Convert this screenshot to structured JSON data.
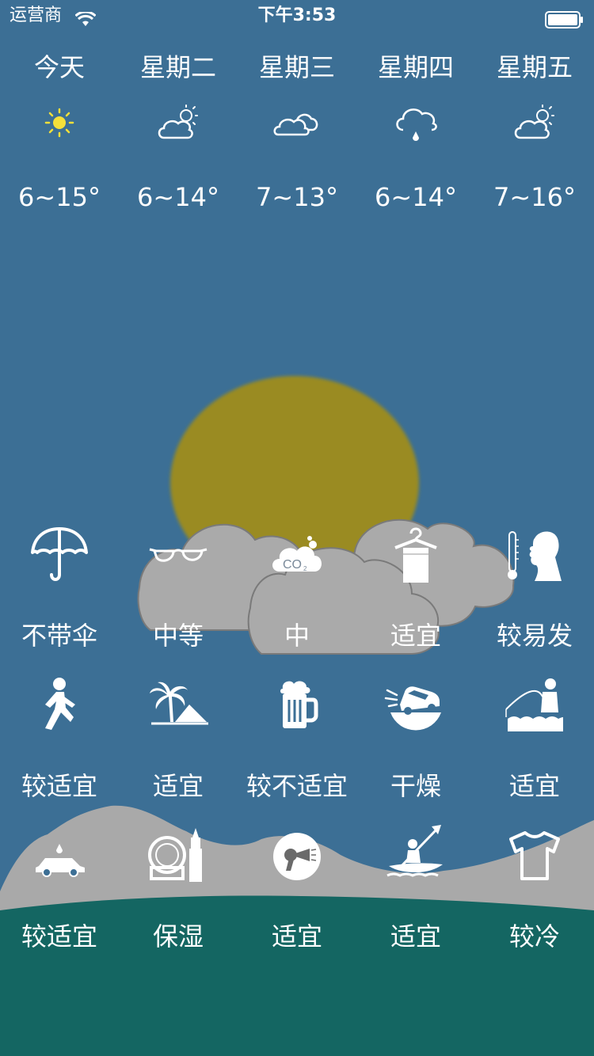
{
  "status": {
    "carrier": "运营商",
    "time": "下午3:53"
  },
  "forecast": [
    {
      "day": "今天",
      "icon": "sun-icon",
      "temp": "6~15°"
    },
    {
      "day": "星期二",
      "icon": "partly-cloudy-icon",
      "temp": "6~14°"
    },
    {
      "day": "星期三",
      "icon": "cloudy-icon",
      "temp": "7~13°"
    },
    {
      "day": "星期四",
      "icon": "rain-icon",
      "temp": "6~14°"
    },
    {
      "day": "星期五",
      "icon": "partly-cloudy-icon",
      "temp": "7~16°"
    }
  ],
  "indices": [
    {
      "icon": "umbrella-icon",
      "label": "不带伞"
    },
    {
      "icon": "sunglasses-icon",
      "label": "中等"
    },
    {
      "icon": "co2-icon",
      "label": "中"
    },
    {
      "icon": "clothes-drying-icon",
      "label": "适宜"
    },
    {
      "icon": "thermometer-person-icon",
      "label": "较易发"
    },
    {
      "icon": "running-person-icon",
      "label": "较适宜"
    },
    {
      "icon": "palm-beach-icon",
      "label": "适宜"
    },
    {
      "icon": "beer-mug-icon",
      "label": "较不适宜"
    },
    {
      "icon": "car-splash-icon",
      "label": "干燥"
    },
    {
      "icon": "fishing-icon",
      "label": "适宜"
    },
    {
      "icon": "car-wash-icon",
      "label": "较适宜"
    },
    {
      "icon": "cosmetics-icon",
      "label": "保湿"
    },
    {
      "icon": "hair-dryer-icon",
      "label": "适宜"
    },
    {
      "icon": "kayaking-icon",
      "label": "适宜"
    },
    {
      "icon": "tshirt-icon",
      "label": "较冷"
    }
  ],
  "colors": {
    "sky": "#3c6f95",
    "sun": "#9a8b20",
    "cloud": "#a8a8a8",
    "ground": "#146662"
  }
}
